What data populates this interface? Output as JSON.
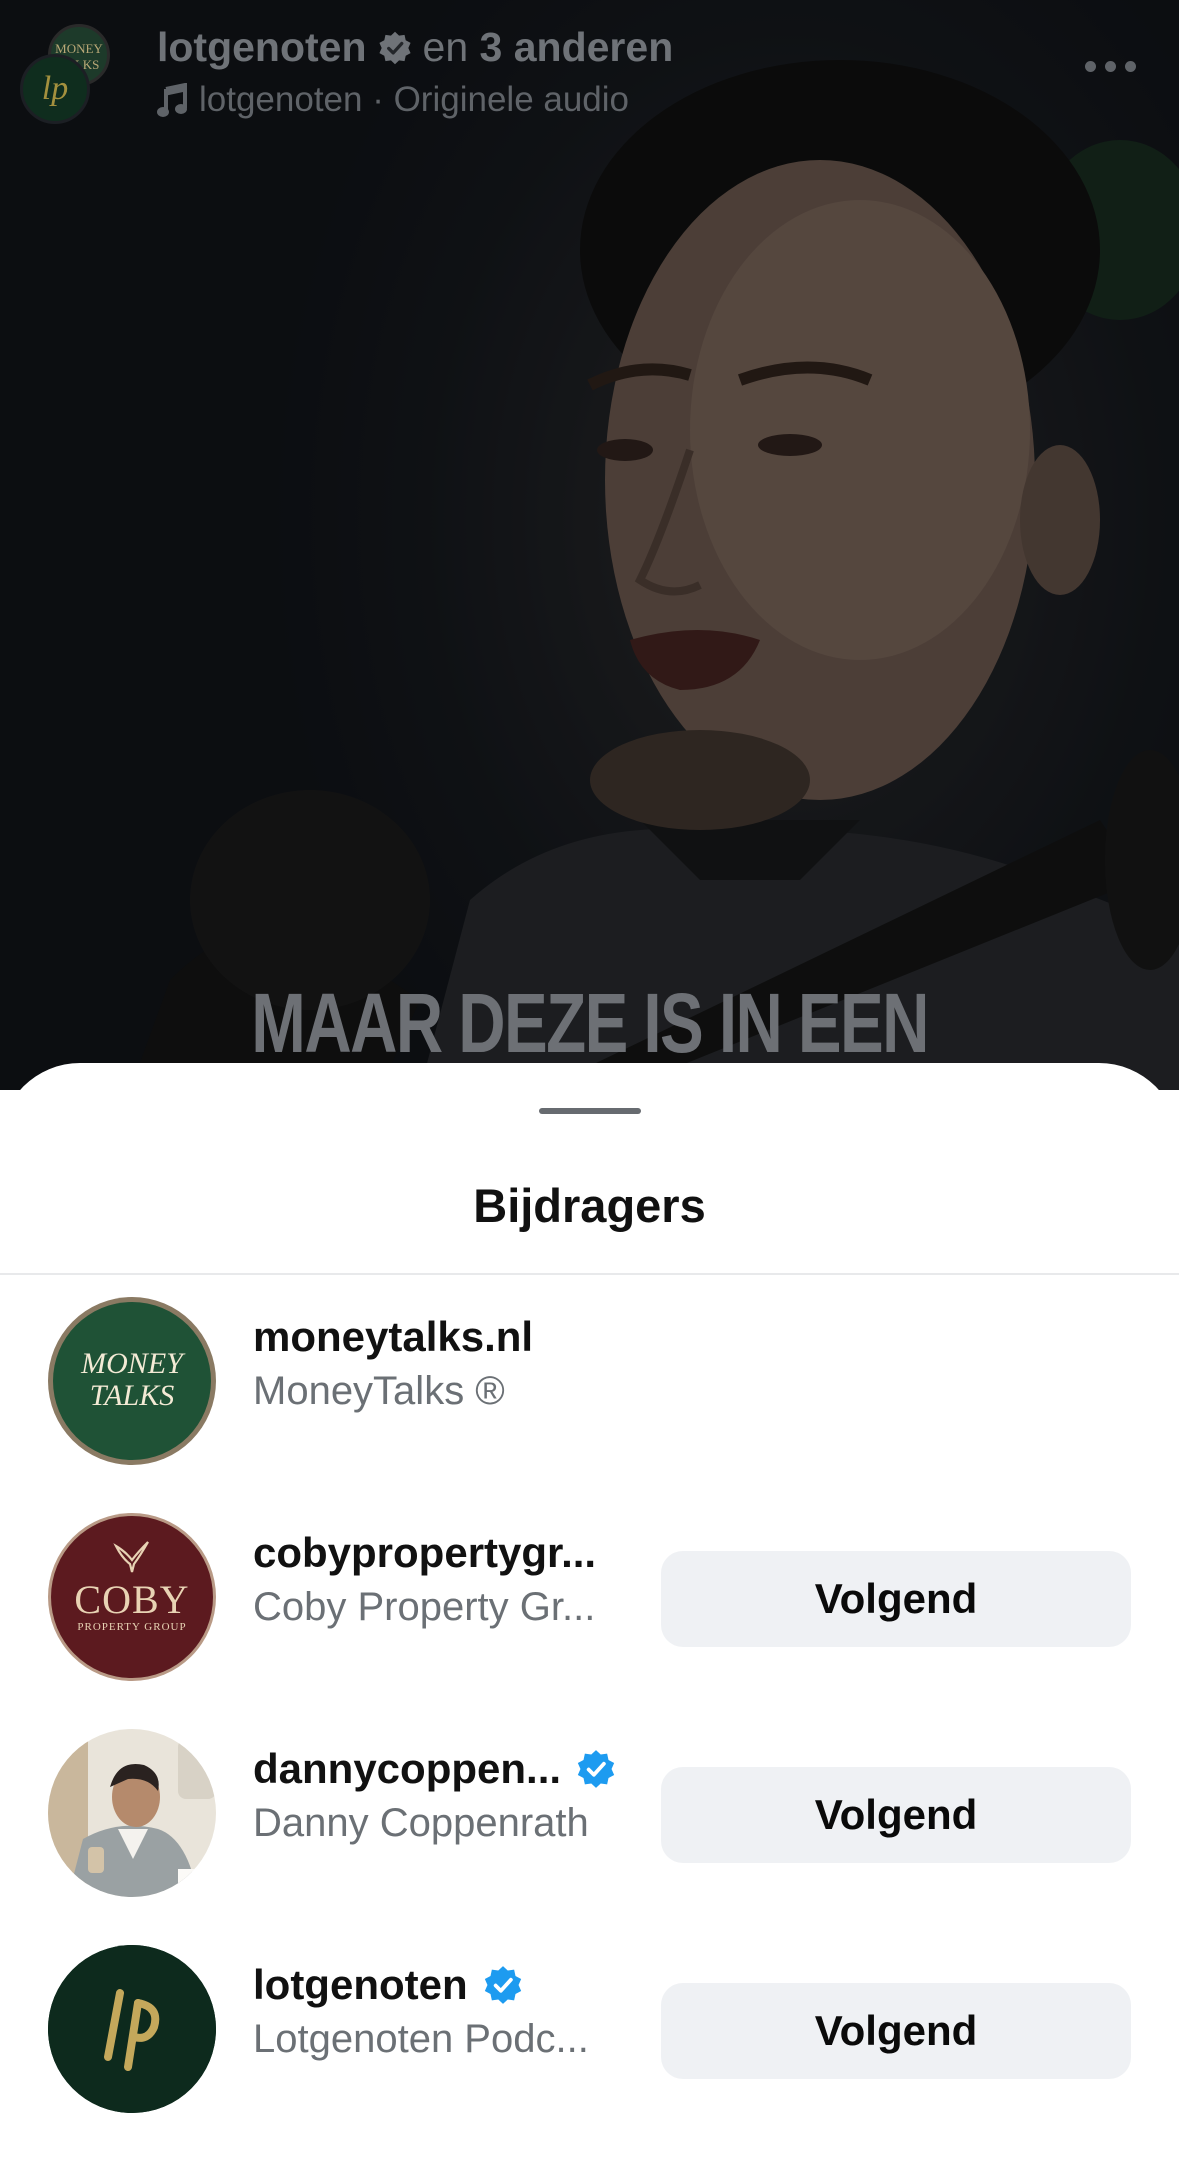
{
  "reel": {
    "author": "lotgenoten",
    "collab_prefix": "en",
    "collab_others": "3 anderen",
    "audio": "lotgenoten · Originele audio",
    "caption": "MAAR DEZE IS IN EEN",
    "avatar_text_top": "MONEY TALKS",
    "avatar_text_bottom": "lp"
  },
  "sheet": {
    "title": "Bijdragers",
    "contributors": [
      {
        "username": "moneytalks.nl",
        "fullname": "MoneyTalks ®",
        "verified": false,
        "button": null,
        "avatar_line1": "MONEY",
        "avatar_line2": "TALKS"
      },
      {
        "username": "cobypropertygr...",
        "fullname": "Coby Property Gr...",
        "verified": false,
        "button": "Volgend",
        "avatar_line1": "COBY",
        "avatar_line2": "PROPERTY GROUP"
      },
      {
        "username": "dannycoppen...",
        "fullname": "Danny Coppenrath",
        "verified": true,
        "button": "Volgend"
      },
      {
        "username": "lotgenoten",
        "fullname": "Lotgenoten Podc...",
        "verified": true,
        "button": "Volgend",
        "avatar_line1": "lp"
      }
    ]
  },
  "colors": {
    "verified_blue": "#1d9bf0",
    "button_bg": "#eff1f4",
    "moneytalks_green": "#1f5236",
    "coby_maroon": "#5c1a1f",
    "lotgenoten_green": "#0d2a1d",
    "gold": "#c4a85b"
  }
}
